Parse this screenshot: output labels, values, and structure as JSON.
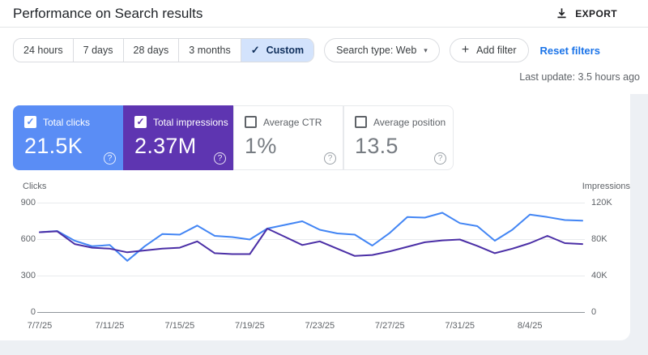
{
  "header": {
    "title": "Performance on Search results",
    "export_label": "EXPORT"
  },
  "filters": {
    "date_ranges": [
      "24 hours",
      "7 days",
      "28 days",
      "3 months",
      "Custom"
    ],
    "selected_range": "Custom",
    "search_type_label": "Search type: Web",
    "add_filter_label": "Add filter",
    "reset_label": "Reset filters",
    "last_update": "Last update: 3.5 hours ago"
  },
  "metrics": [
    {
      "label": "Total clicks",
      "value": "21.5K",
      "selected": true,
      "color": "#5a8df5"
    },
    {
      "label": "Total impressions",
      "value": "2.37M",
      "selected": true,
      "color": "#5e35b1"
    },
    {
      "label": "Average CTR",
      "value": "1%",
      "selected": false,
      "color": "#ffffff"
    },
    {
      "label": "Average position",
      "value": "13.5",
      "selected": false,
      "color": "#ffffff"
    }
  ],
  "icons": {
    "download-icon": "⬇",
    "check-icon": "✓",
    "chevron-down-icon": "▾",
    "plus-icon": "+",
    "help-icon": "?"
  },
  "colors": {
    "clicks_line": "#4285f4",
    "impressions_line": "#4b2fa6",
    "clicks_card": "#5a8df5",
    "impressions_card": "#5e35b1",
    "selected_chip_bg": "#d3e3fc",
    "link_blue": "#1a73e8"
  },
  "chart_data": {
    "type": "line",
    "grid": true,
    "legend_position": "none",
    "x": [
      "7/7/25",
      "7/8/25",
      "7/9/25",
      "7/10/25",
      "7/11/25",
      "7/12/25",
      "7/13/25",
      "7/14/25",
      "7/15/25",
      "7/16/25",
      "7/17/25",
      "7/18/25",
      "7/19/25",
      "7/20/25",
      "7/21/25",
      "7/22/25",
      "7/23/25",
      "7/24/25",
      "7/25/25",
      "7/26/25",
      "7/27/25",
      "7/28/25",
      "7/29/25",
      "7/30/25",
      "7/31/25",
      "8/1/25",
      "8/2/25",
      "8/3/25",
      "8/4/25",
      "8/5/25",
      "8/6/25",
      "8/7/25"
    ],
    "x_tick_indices": [
      0,
      4,
      8,
      12,
      16,
      20,
      24,
      28
    ],
    "x_tick_labels": [
      "7/7/25",
      "7/11/25",
      "7/15/25",
      "7/19/25",
      "7/23/25",
      "7/27/25",
      "7/31/25",
      "8/4/25"
    ],
    "series": [
      {
        "name": "Clicks",
        "axis": "left",
        "color": "#4285f4",
        "values": [
          660,
          670,
          590,
          545,
          555,
          425,
          545,
          645,
          640,
          715,
          630,
          620,
          600,
          690,
          720,
          750,
          680,
          650,
          640,
          550,
          655,
          785,
          780,
          820,
          735,
          710,
          590,
          680,
          805,
          785,
          760,
          755
        ]
      },
      {
        "name": "Impressions",
        "axis": "right",
        "color": "#4b2fa6",
        "values": [
          88000,
          89000,
          75000,
          71000,
          70000,
          66000,
          68000,
          70000,
          71000,
          78000,
          65000,
          64000,
          64000,
          92000,
          83000,
          74000,
          78000,
          70000,
          62000,
          63000,
          67000,
          72000,
          77000,
          79000,
          80000,
          73000,
          65000,
          70000,
          76000,
          84000,
          76000,
          75000
        ]
      }
    ],
    "left_axis": {
      "label": "Clicks",
      "max": 900,
      "ticks": [
        "900",
        "600",
        "300",
        "0"
      ]
    },
    "right_axis": {
      "label": "Impressions",
      "max": 120000,
      "ticks": [
        "120K",
        "80K",
        "40K",
        "0"
      ]
    }
  }
}
